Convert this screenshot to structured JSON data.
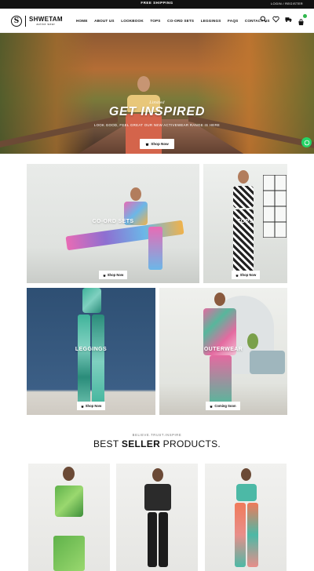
{
  "topbar": {
    "shipping": "FREE SHIPPING",
    "login": "LOGIN / REGISTER"
  },
  "brand": {
    "mark": "S",
    "name": "SHWETAM",
    "tagline": "active wear"
  },
  "nav": [
    "HOME",
    "ABOUT US",
    "LOOKBOOK",
    "TOPS",
    "CO-ORD SETS",
    "LEGGINGS",
    "FAQS",
    "CONTACT US"
  ],
  "header_icons": [
    "search-icon",
    "heart-icon",
    "truck-icon",
    "cart-icon"
  ],
  "colors": {
    "accent": "#2fb84d",
    "whatsapp": "#25d366",
    "dark": "#111111"
  },
  "hero": {
    "script": "Limited",
    "title": "GET INSPIRED",
    "subtitle": "LOOK GOOD, FEEL GREAT OUR NEW ACTIVEWEAR RANGE IS HERE",
    "button": "Shop Now"
  },
  "categories": {
    "coord": {
      "label": "CO-ORD SETS",
      "button": "Shop Now"
    },
    "tops": {
      "label": "TOPS",
      "button": "Shop Now"
    },
    "leggings": {
      "label": "LEGGINGS",
      "button": "Shop Now"
    },
    "outerwear": {
      "label": "OUTERWEAR",
      "button": "Coming Soon"
    }
  },
  "best_sellers": {
    "eyebrow": "BELIEVE.TRUST.INSPIRE",
    "title_plain_1": "BEST ",
    "title_bold": "SELLER",
    "title_plain_2": " PRODUCTS."
  }
}
